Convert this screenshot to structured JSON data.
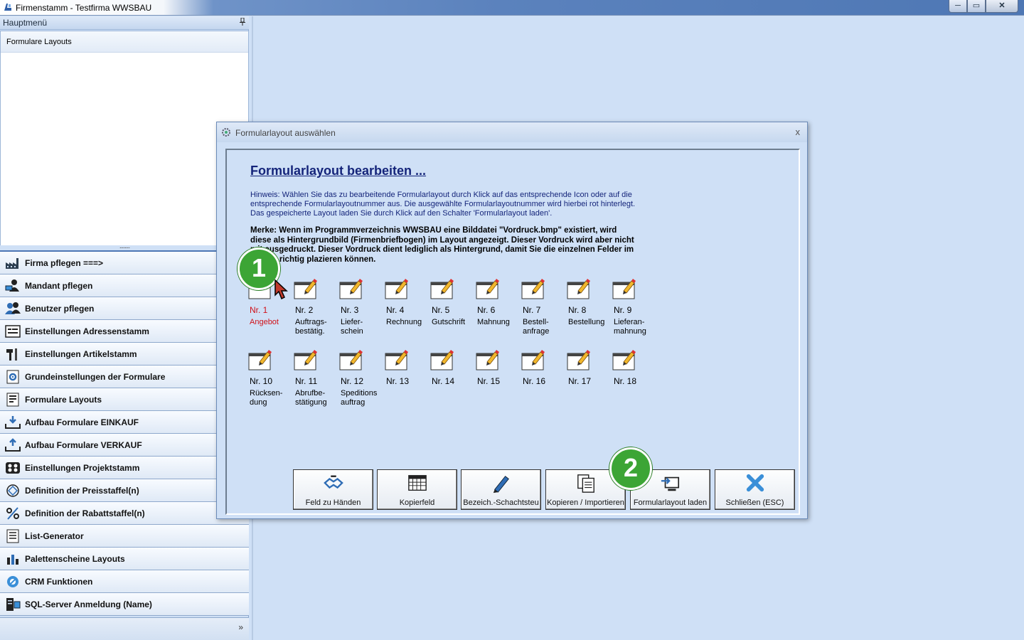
{
  "window": {
    "title": "Firmenstamm - Testfirma WWSBAU",
    "min": "─",
    "max": "▭",
    "close": "✕"
  },
  "sidebar": {
    "header": "Hauptmenü",
    "pin": "🖈",
    "selected_item": "Formulare Layouts",
    "splitter": "........",
    "more": "»",
    "items": [
      {
        "label": "Firma pflegen   ===>",
        "icon": "factory-icon"
      },
      {
        "label": "Mandant pflegen",
        "icon": "user-computer-icon"
      },
      {
        "label": "Benutzer pflegen",
        "icon": "users-icon"
      },
      {
        "label": "Einstellungen Adressenstamm",
        "icon": "address-card-icon"
      },
      {
        "label": "Einstellungen Artikelstamm",
        "icon": "tools-icon"
      },
      {
        "label": "Grundeinstellungen der Formulare",
        "icon": "gear-document-icon"
      },
      {
        "label": "Formulare Layouts",
        "icon": "form-layout-icon"
      },
      {
        "label": "Aufbau Formulare EINKAUF",
        "icon": "tray-in-icon"
      },
      {
        "label": "Aufbau Formulare VERKAUF",
        "icon": "tray-out-icon"
      },
      {
        "label": "Einstellungen Projektstamm",
        "icon": "project-icon"
      },
      {
        "label": "Definition der Preisstaffel(n)",
        "icon": "price-scale-icon"
      },
      {
        "label": "Definition der Rabattstaffel(n)",
        "icon": "percent-icon"
      },
      {
        "label": "List-Generator",
        "icon": "list-icon"
      },
      {
        "label": "Palettenscheine Layouts",
        "icon": "pallet-icon"
      },
      {
        "label": "CRM Funktionen",
        "icon": "crm-icon"
      },
      {
        "label": "SQL-Server Anmeldung (Name)",
        "icon": "server-icon"
      }
    ]
  },
  "dialog": {
    "title": "Formularlayout auswählen",
    "close": "x",
    "heading": "Formularlayout bearbeiten ...",
    "hint": "Hinweis: Wählen Sie das zu bearbeitende Formularlayout durch Klick auf das entsprechende Icon oder auf die entsprechende Formularlayoutnummer aus. Die ausgewählte Formularlayoutnummer wird hierbei rot hinterlegt. Das gespeicherte Layout laden Sie durch Klick auf den Schalter 'Formularlayout laden'.",
    "merke": "Merke: Wenn im Programmverzeichnis WWSBAU eine Bilddatei \"Vordruck.bmp\" existiert, wird diese als Hintergrundbild (Firmenbriefbogen) im Layout angezeigt. Dieser Vordruck wird aber nicht mit ausgedruckt. Dieser Vordruck dient lediglich als Hintergrund, damit Sie die einzelnen Felder im Layout richtig plazieren können.",
    "layouts": [
      {
        "num": "Nr. 1",
        "name": "Angebot",
        "selected": true
      },
      {
        "num": "Nr. 2",
        "name": "Auftrags-\nbestätig."
      },
      {
        "num": "Nr. 3",
        "name": "Liefer-\nschein"
      },
      {
        "num": "Nr. 4",
        "name": "Rechnung"
      },
      {
        "num": "Nr. 5",
        "name": "Gutschrift"
      },
      {
        "num": "Nr. 6",
        "name": "Mahnung"
      },
      {
        "num": "Nr. 7",
        "name": "Bestell-\nanfrage"
      },
      {
        "num": "Nr. 8",
        "name": "Bestellung"
      },
      {
        "num": "Nr. 9",
        "name": "Lieferan-\nmahnung"
      },
      {
        "num": "Nr. 10",
        "name": "Rücksen-\ndung"
      },
      {
        "num": "Nr. 11",
        "name": "Abrufbe-\nstätigung"
      },
      {
        "num": "Nr. 12",
        "name": "Speditions\nauftrag"
      },
      {
        "num": "Nr. 13",
        "name": ""
      },
      {
        "num": "Nr. 14",
        "name": ""
      },
      {
        "num": "Nr. 15",
        "name": ""
      },
      {
        "num": "Nr. 16",
        "name": ""
      },
      {
        "num": "Nr. 17",
        "name": ""
      },
      {
        "num": "Nr. 18",
        "name": ""
      }
    ],
    "buttons": [
      {
        "label": "Feld zu Händen",
        "icon": "handshake-icon"
      },
      {
        "label": "Kopierfeld",
        "icon": "grid-icon"
      },
      {
        "label": "Bezeich.-Schachtsteu",
        "icon": "pen-icon"
      },
      {
        "label": "Kopieren / Importieren",
        "icon": "copy-document-icon"
      },
      {
        "label": "Formularlayout laden",
        "icon": "load-computer-icon"
      },
      {
        "label": "Schließen (ESC)",
        "icon": "close-x-icon"
      }
    ]
  },
  "badges": {
    "first": "1",
    "second": "2"
  },
  "colors": {
    "selected_text": "#d01018",
    "heading": "#14247a",
    "badge": "#3ca535"
  }
}
